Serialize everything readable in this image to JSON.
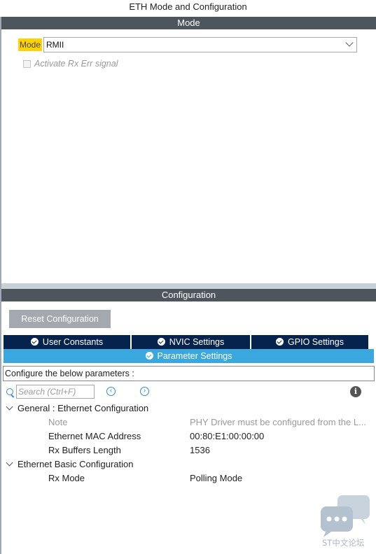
{
  "window": {
    "title": "ETH Mode and Configuration"
  },
  "mode_section": {
    "header": "Mode",
    "mode_label": "Mode",
    "mode_value": "RMII",
    "checkbox_label": "Activate Rx Err signal",
    "checkbox_checked": false,
    "checkbox_enabled": false
  },
  "config_section": {
    "header": "Configuration",
    "reset_button": "Reset Configuration",
    "tabs": [
      {
        "label": "User Constants",
        "status_icon": "check-circle-icon"
      },
      {
        "label": "NVIC Settings",
        "status_icon": "check-circle-icon"
      },
      {
        "label": "GPIO Settings",
        "status_icon": "check-circle-icon"
      },
      {
        "label": "Parameter Settings",
        "status_icon": "check-circle-icon",
        "active": true
      }
    ],
    "params_header": "Configure the below parameters :",
    "search_placeholder": "Search (Ctrl+F)",
    "groups": [
      {
        "title": "General : Ethernet Configuration",
        "params": [
          {
            "name": "Note",
            "value": "PHY Driver must be configured from the L...",
            "muted": true
          },
          {
            "name": "Ethernet MAC Address",
            "value": "00:80:E1:00:00:00"
          },
          {
            "name": "Rx Buffers Length",
            "value": "1536"
          }
        ]
      },
      {
        "title": "Ethernet Basic Configuration",
        "params": [
          {
            "name": "Rx Mode",
            "value": "Polling Mode"
          }
        ]
      }
    ]
  },
  "watermark": {
    "text": "ST中文论坛",
    "icon": "chat-bubbles-icon"
  },
  "colors": {
    "section_bar": "#4d555d",
    "tab_dark": "#06234e",
    "tab_active": "#3aa8df",
    "mode_highlight": "#ffd200",
    "reset_button": "#a3a9af"
  }
}
